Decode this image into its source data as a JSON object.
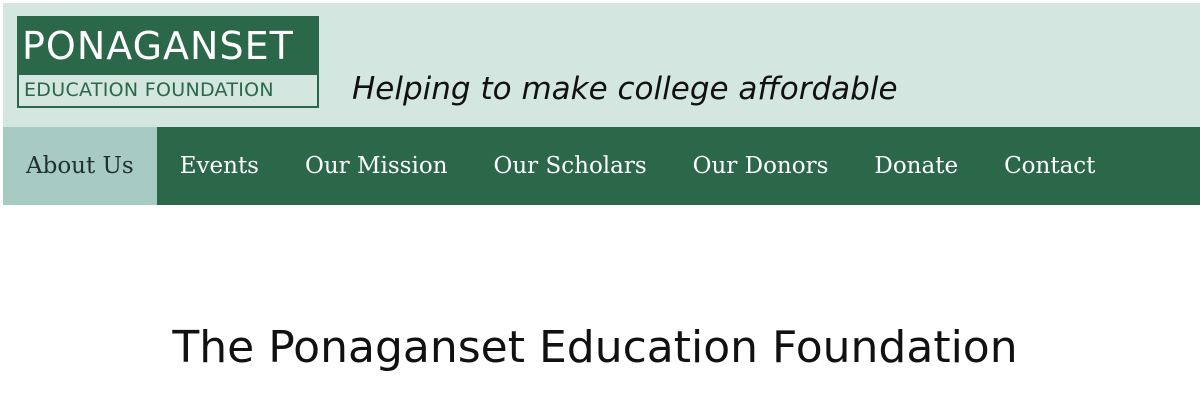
{
  "logo": {
    "top_text": "PONAGANSET",
    "bottom_text": "EDUCATION FOUNDATION"
  },
  "tagline": "Helping to make college affordable",
  "nav": {
    "items": [
      {
        "label": "About Us",
        "active": true
      },
      {
        "label": "Events",
        "active": false
      },
      {
        "label": "Our Mission",
        "active": false
      },
      {
        "label": "Our Scholars",
        "active": false
      },
      {
        "label": "Our Donors",
        "active": false
      },
      {
        "label": "Donate",
        "active": false
      },
      {
        "label": "Contact",
        "active": false
      }
    ]
  },
  "main": {
    "title": "The Ponaganset Education Foundation"
  },
  "colors": {
    "header_bg": "#d3e6e0",
    "brand_green": "#2b6749",
    "active_tab": "#a7cac2"
  }
}
